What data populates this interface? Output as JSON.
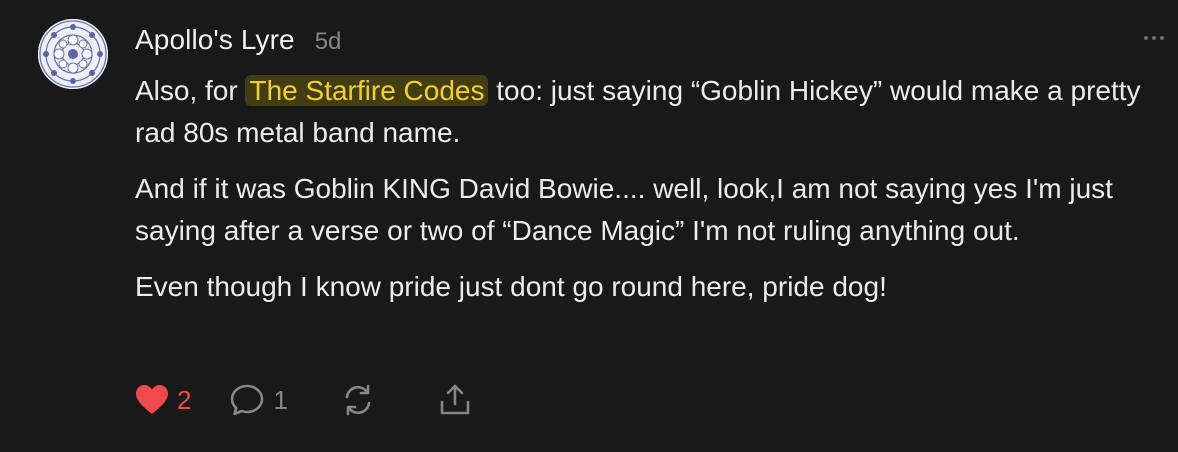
{
  "comment": {
    "author": "Apollo's Lyre",
    "time": "5d",
    "avatar_icon": "mandala-avatar",
    "paragraphs": {
      "p1_before": "Also, for ",
      "p1_mention": "The Starfire Codes",
      "p1_after": " too: just saying “Goblin Hickey” would make a pretty rad 80s metal band name.",
      "p2": "And if it was Goblin KING David Bowie.... well, look,I am not saying yes I'm just saying after a verse or two of “Dance Magic” I'm not ruling anything out.",
      "p3": "Even though I know pride just dont go round here, pride dog!"
    },
    "actions": {
      "like_count": "2",
      "reply_count": "1"
    }
  },
  "colors": {
    "background": "#19191a",
    "text": "#ececec",
    "muted": "#86868a",
    "like": "#ef4a4a",
    "mention_text": "#f5d020",
    "mention_bg": "#433d14"
  }
}
